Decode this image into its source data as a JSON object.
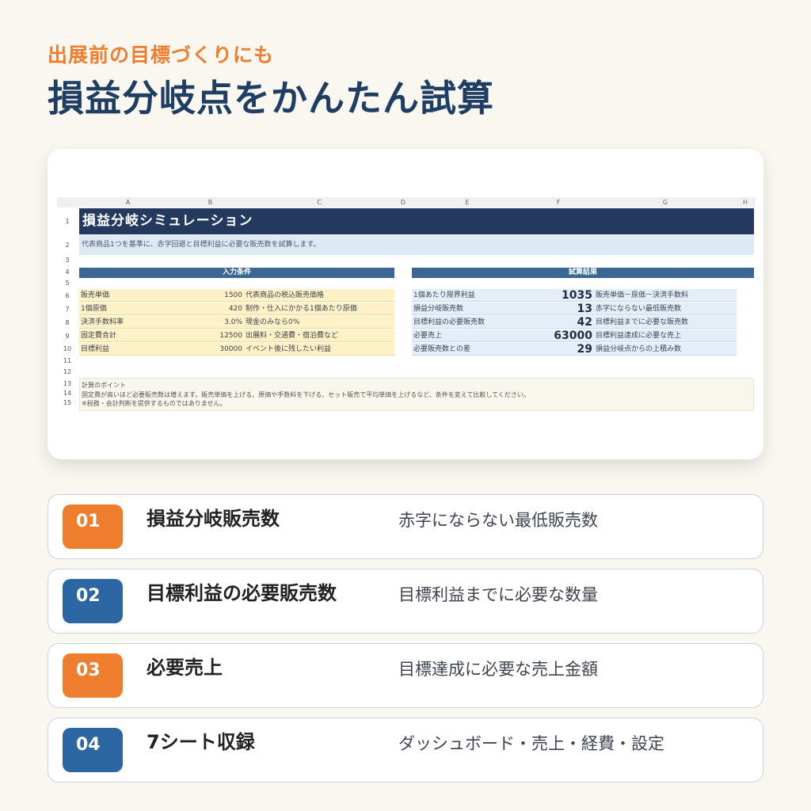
{
  "header": {
    "subtitle": "出展前の目標づくりにも",
    "title": "損益分岐点をかんたん試算"
  },
  "sheet": {
    "columns": [
      "A",
      "B",
      "C",
      "D",
      "E",
      "F",
      "G",
      "H"
    ],
    "rows": [
      "1",
      "2",
      "3",
      "4",
      "5",
      "6",
      "7",
      "8",
      "9",
      "10",
      "11",
      "12",
      "13",
      "14",
      "15"
    ],
    "title": "損益分岐シミュレーション",
    "description": "代表商品1つを基準に、赤字回避と目標利益に必要な販売数を試算します。",
    "input_header": "入力条件",
    "output_header": "試算結果",
    "inputs": [
      {
        "label": "販売単価",
        "value": "1500",
        "note": "代表商品の税込販売価格"
      },
      {
        "label": "1個原価",
        "value": "420",
        "note": "制作・仕入にかかる1個あたり原価"
      },
      {
        "label": "決済手数料率",
        "value": "3.0%",
        "note": "現金のみなら0%"
      },
      {
        "label": "固定費合計",
        "value": "12500",
        "note": "出展料・交通費・宿泊費など"
      },
      {
        "label": "目標利益",
        "value": "30000",
        "note": "イベント後に残したい利益"
      }
    ],
    "outputs": [
      {
        "label": "1個あたり限界利益",
        "value": "1035",
        "note": "販売単価－原価－決済手数料"
      },
      {
        "label": "損益分岐販売数",
        "value": "13",
        "note": "赤字にならない最低販売数"
      },
      {
        "label": "目標利益の必要販売数",
        "value": "42",
        "note": "目標利益までに必要な販売数"
      },
      {
        "label": "必要売上",
        "value": "63000",
        "note": "目標利益達成に必要な売上"
      },
      {
        "label": "必要販売数との差",
        "value": "29",
        "note": "損益分岐点からの上積み数"
      }
    ],
    "notes": [
      "計算のポイント",
      "固定費が高いほど必要販売数は増えます。販売単価を上げる、原価や手数料を下げる、セット販売で平均単価を上げるなど、条件を変えて比較してください。",
      "※税務・会計判断を提供するものではありません。"
    ]
  },
  "features": [
    {
      "num": "01",
      "name": "損益分岐販売数",
      "desc": "赤字にならない最低販売数",
      "color": "#ef7d2e"
    },
    {
      "num": "02",
      "name": "目標利益の必要販売数",
      "desc": "目標利益までに必要な数量",
      "color": "#2c66a3"
    },
    {
      "num": "03",
      "name": "必要売上",
      "desc": "目標達成に必要な売上金額",
      "color": "#ef7d2e"
    },
    {
      "num": "04",
      "name": "7シート収録",
      "desc": "ダッシュボード・売上・経費・設定",
      "color": "#2c66a3"
    }
  ]
}
